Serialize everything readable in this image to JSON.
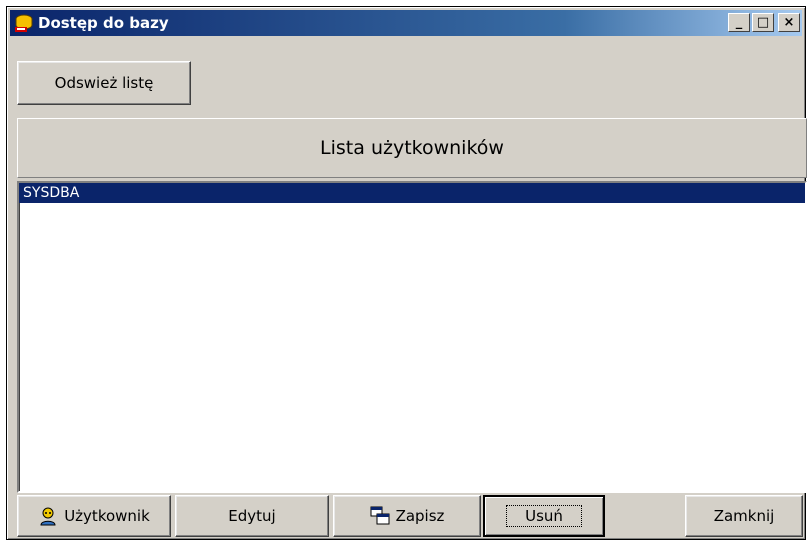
{
  "window": {
    "title": "Dostęp do bazy",
    "controls": {
      "minimize": "_",
      "maximize": "□",
      "close": "×"
    }
  },
  "toolbar": {
    "refresh_label": "Odswież listę"
  },
  "list": {
    "header": "Lista użytkowników",
    "items": [
      "SYSDBA"
    ],
    "selected_index": 0
  },
  "buttons": {
    "user_label": "Użytkownik",
    "edit_label": "Edytuj",
    "save_label": "Zapisz",
    "delete_label": "Usuń",
    "close_label": "Zamknij"
  },
  "icons": {
    "app": "database-key-icon",
    "user": "user-search-icon",
    "save": "save-window-icon"
  },
  "colors": {
    "titlebar": "#0a246a",
    "selection": "#0a246a",
    "face": "#d4d0c8"
  }
}
